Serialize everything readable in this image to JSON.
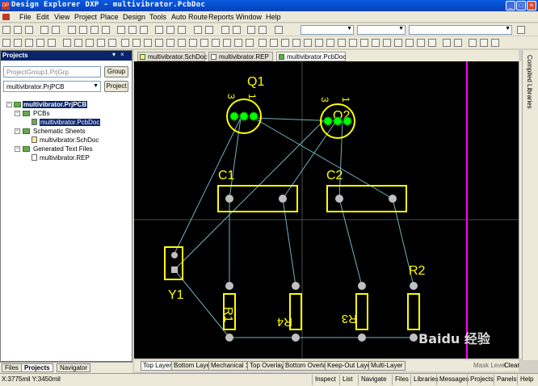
{
  "window": {
    "title": "Design Explorer DXP - multivibrator.PcbDoc",
    "icon": "app-logo-icon"
  },
  "menu": [
    "File",
    "Edit",
    "View",
    "Project",
    "Place",
    "Design",
    "Tools",
    "Auto Route",
    "Reports",
    "Window",
    "Help"
  ],
  "panel": {
    "title": "Projects",
    "workspace_field": "ProjectGroup1.PrjGrp",
    "group_button": "Group",
    "project_field": "multivibrator.PrjPCB",
    "project_button": "Project",
    "tree": {
      "root": "multivibrator.PrjPCB",
      "pcbs_folder": "PCBs",
      "pcb_doc": "multivibrator.PcbDoc",
      "sch_folder": "Schematic Sheets",
      "sch_doc": "multivibrator.SchDoc",
      "gen_folder": "Generated Text Files",
      "rep_doc": "multivibrator.REP"
    },
    "tabs": [
      "Files",
      "Projects",
      "Navigator"
    ]
  },
  "doc_tabs": [
    "multivibrator.SchDoc",
    "multivibrator.REP",
    "multivibrator.PcbDoc"
  ],
  "layer_tabs": [
    "Top Layer",
    "Bottom Layer",
    "Mechanical 1",
    "Top Overlay",
    "Bottom Overlay",
    "Keep-Out Layer",
    "Multi-Layer"
  ],
  "layer_extra": {
    "mask": "Mask Level",
    "clear": "Clear"
  },
  "right_tabs": [
    "Compiled",
    "Libraries"
  ],
  "status": {
    "coords": "X:3775mil Y:3450mil",
    "buttons": [
      "Inspect",
      "List",
      "Navigate",
      "Files",
      "Libraries",
      "Messages",
      "Projects",
      "Panels",
      "Help"
    ]
  },
  "pcb": {
    "designators": {
      "q1": "Q1",
      "q2": "Q2",
      "c1": "C1",
      "c2": "C2",
      "y1": "Y1",
      "r2": "R2",
      "r1": "R1",
      "r4": "R4",
      "r3": "R3"
    },
    "pin_labels": {
      "q1_left": "3",
      "q1_right": "1",
      "q2_left": "3",
      "q2_right": "1"
    },
    "colors": {
      "overlay": "#ffff00",
      "pad": "#c0c0c0",
      "tpad": "#00ff00",
      "ratsnest": "#6fb2c0",
      "board_edge": "#ff00ff"
    }
  },
  "watermark": "Baidu 经验"
}
